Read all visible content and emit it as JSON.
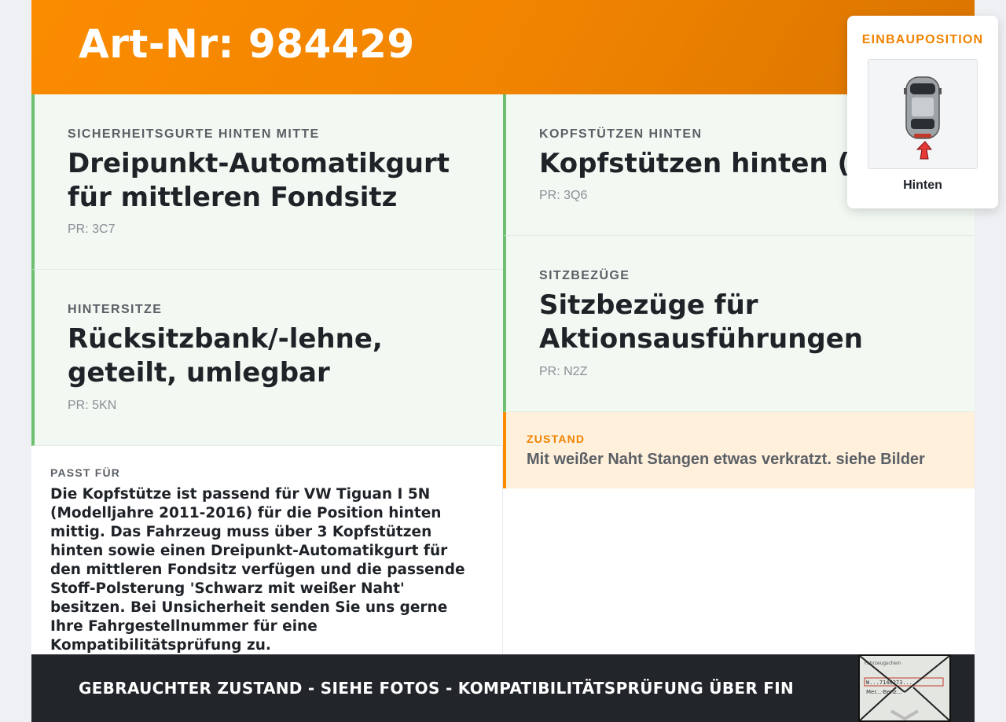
{
  "header": {
    "title": "Art-Nr: 984429"
  },
  "features": [
    {
      "category": "SICHERHEITSGURTE HINTEN MITTE",
      "title": "Dreipunkt-Automatikgurt für mittleren Fondsitz",
      "pr": "PR: 3C7"
    },
    {
      "category": "HINTERSITZE",
      "title": "Rücksitzbank/-lehne, geteilt, umlegbar",
      "pr": "PR: 5KN"
    },
    {
      "category": "KOPFSTÜTZEN HINTEN",
      "title": "Kopfstützen hinten (3)",
      "pr": "PR: 3Q6"
    },
    {
      "category": "SITZBEZÜGE",
      "title": "Sitzbezüge für Aktionsausführungen",
      "pr": "PR: N2Z"
    }
  ],
  "fits": {
    "label": "PASST FÜR",
    "text": "Die Kopfstütze ist passend für VW Tiguan I 5N (Modelljahre 2011-2016) für die Position hinten mittig. Das Fahrzeug muss über 3 Kopfstützen hinten sowie einen Dreipunkt-Automatikgurt für den mittleren Fondsitz verfügen und die passende Stoff-Polsterung 'Schwarz mit weißer Naht' besitzen. Bei Unsicherheit senden Sie uns gerne Ihre Fahrgestellnummer für eine Kompatibilitätsprüfung zu."
  },
  "condition": {
    "label": "ZUSTAND",
    "text": "Mit weißer Naht Stangen etwas verkratzt. siehe Bilder"
  },
  "position": {
    "label": "EINBAUPOSITION",
    "caption": "Hinten",
    "icon": "car-top-view-rear-arrow-icon"
  },
  "footer": {
    "text": "GEBRAUCHTER ZUSTAND - SIEHE FOTOS - KOMPATIBILITÄTSPRÜFUNG ÜBER FIN",
    "thumb_lines": [
      "Fahrzeugschein",
      "W...7146273...",
      "Mer...-Benz..."
    ]
  },
  "colors": {
    "accent": "#fb8c00",
    "feature_border": "#6cc070",
    "feature_bg": "#f2f8f2",
    "condition_bg": "#fff0dc",
    "footer_bg": "#22252a"
  }
}
